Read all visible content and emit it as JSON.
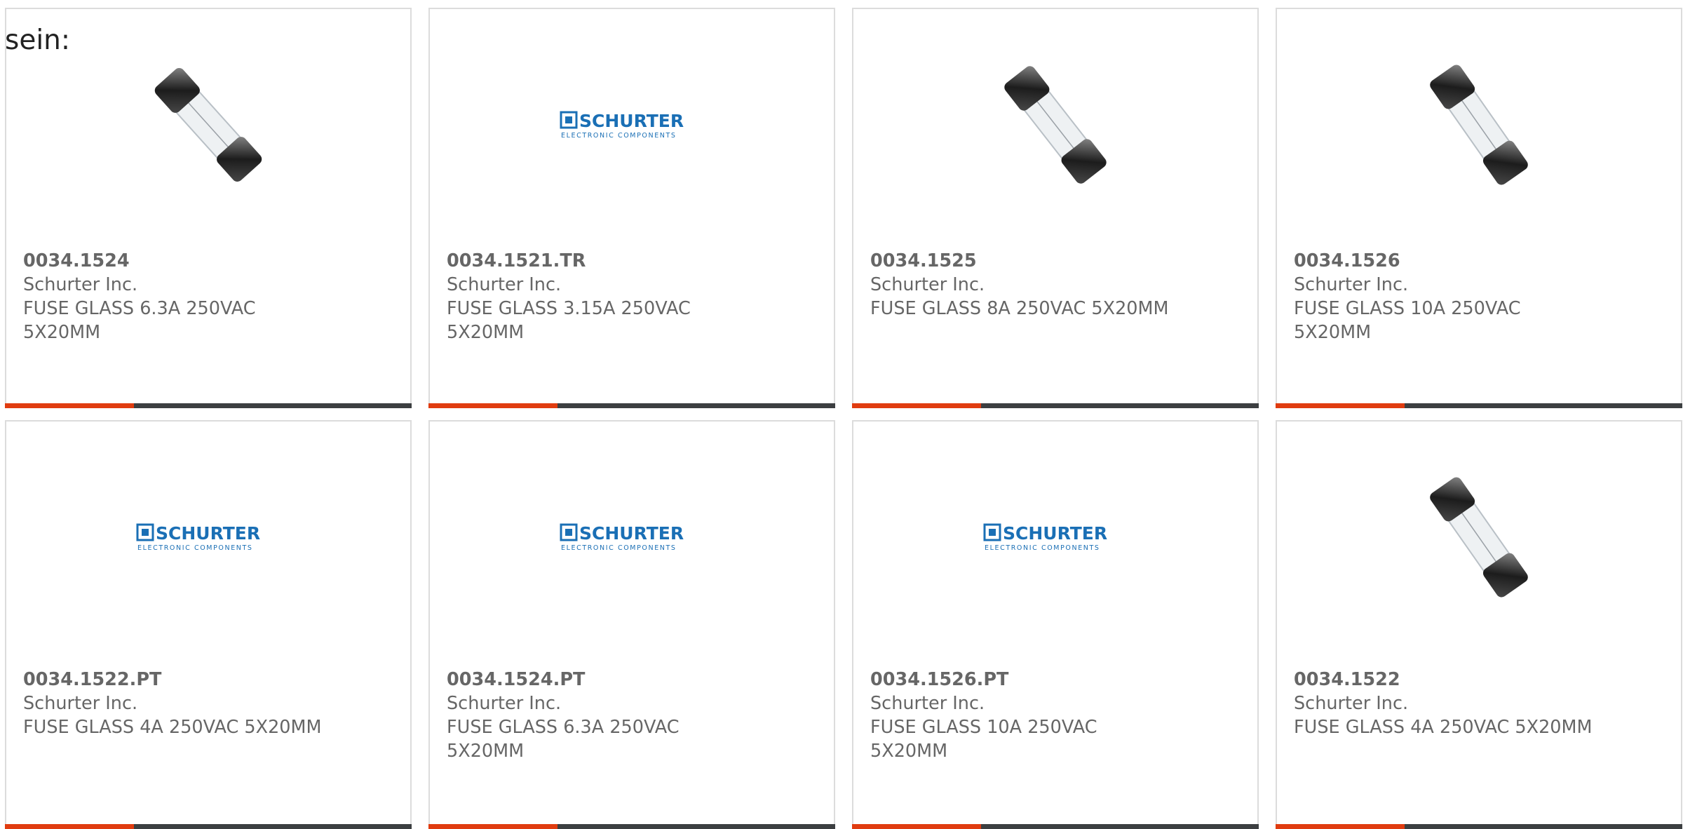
{
  "lead_text": "sein:",
  "colors": {
    "accent": "#e03c10",
    "bar_dark": "#3c3f41",
    "logo_blue": "#1a6fb5"
  },
  "logo": {
    "name": "SCHURTER",
    "tagline": "ELECTRONIC COMPONENTS"
  },
  "products": [
    {
      "part": "0034.1524",
      "mfr": "Schurter Inc.",
      "desc": "FUSE GLASS 6.3A 250VAC 5X20MM",
      "image": "fuse-image"
    },
    {
      "part": "0034.1521.TR",
      "mfr": "Schurter Inc.",
      "desc": "FUSE GLASS 3.15A 250VAC 5X20MM",
      "image": "schurter-logo"
    },
    {
      "part": "0034.1525",
      "mfr": "Schurter Inc.",
      "desc": "FUSE GLASS 8A 250VAC 5X20MM",
      "image": "fuse-image"
    },
    {
      "part": "0034.1526",
      "mfr": "Schurter Inc.",
      "desc": "FUSE GLASS 10A 250VAC 5X20MM",
      "image": "fuse-image"
    },
    {
      "part": "0034.1522.PT",
      "mfr": "Schurter Inc.",
      "desc": "FUSE GLASS 4A 250VAC 5X20MM",
      "image": "schurter-logo"
    },
    {
      "part": "0034.1524.PT",
      "mfr": "Schurter Inc.",
      "desc": "FUSE GLASS 6.3A 250VAC 5X20MM",
      "image": "schurter-logo"
    },
    {
      "part": "0034.1526.PT",
      "mfr": "Schurter Inc.",
      "desc": "FUSE GLASS 10A 250VAC 5X20MM",
      "image": "schurter-logo"
    },
    {
      "part": "0034.1522",
      "mfr": "Schurter Inc.",
      "desc": "FUSE GLASS 4A 250VAC 5X20MM",
      "image": "fuse-image"
    }
  ]
}
